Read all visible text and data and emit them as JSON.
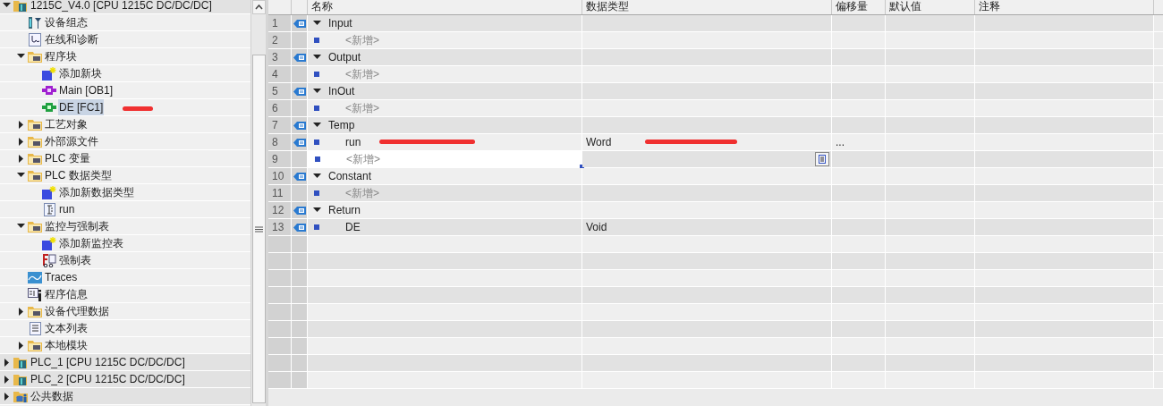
{
  "project_tree": {
    "items": [
      {
        "label": "1215C_V4.0 [CPU 1215C DC/DC/DC]",
        "kind": "plc",
        "expanded": true,
        "selected": false,
        "children": [
          {
            "label": "设备组态",
            "kind": "config",
            "selected": false
          },
          {
            "label": "在线和诊断",
            "kind": "diag",
            "selected": false
          },
          {
            "label": "程序块",
            "kind": "folder",
            "expanded": true,
            "selected": false,
            "children": [
              {
                "label": "添加新块",
                "kind": "add",
                "selected": false
              },
              {
                "label": "Main [OB1]",
                "kind": "ob",
                "selected": false
              },
              {
                "label": "DE [FC1]",
                "kind": "fc",
                "selected": true
              }
            ]
          },
          {
            "label": "工艺对象",
            "kind": "folder",
            "expanded": false,
            "selected": false
          },
          {
            "label": "外部源文件",
            "kind": "folder",
            "expanded": false,
            "selected": false
          },
          {
            "label": "PLC 变量",
            "kind": "folder",
            "expanded": false,
            "selected": false
          },
          {
            "label": "PLC 数据类型",
            "kind": "folder",
            "expanded": true,
            "selected": false,
            "children": [
              {
                "label": "添加新数据类型",
                "kind": "add",
                "selected": false
              },
              {
                "label": "run",
                "kind": "type",
                "selected": false
              }
            ]
          },
          {
            "label": "监控与强制表",
            "kind": "folder",
            "expanded": true,
            "selected": false,
            "children": [
              {
                "label": "添加新监控表",
                "kind": "add",
                "selected": false
              },
              {
                "label": "强制表",
                "kind": "force",
                "selected": false
              }
            ]
          },
          {
            "label": "Traces",
            "kind": "trace",
            "selected": false
          },
          {
            "label": "程序信息",
            "kind": "info",
            "selected": false
          },
          {
            "label": "设备代理数据",
            "kind": "folder",
            "expanded": false,
            "selected": false
          },
          {
            "label": "文本列表",
            "kind": "textlist",
            "selected": false
          },
          {
            "label": "本地模块",
            "kind": "folder",
            "expanded": false,
            "selected": false
          }
        ]
      },
      {
        "label": "PLC_1 [CPU 1215C DC/DC/DC]",
        "kind": "plc",
        "expanded": false,
        "selected": false
      },
      {
        "label": "PLC_2 [CPU 1215C DC/DC/DC]",
        "kind": "plc",
        "expanded": false,
        "selected": false
      },
      {
        "label": "公共数据",
        "kind": "common",
        "expanded": false,
        "selected": false
      }
    ]
  },
  "interface_table": {
    "columns": [
      "名称",
      "数据类型",
      "偏移量",
      "默认值",
      "注释"
    ],
    "rows": [
      {
        "number": "1",
        "kind": "section",
        "name": "Input",
        "selected": false
      },
      {
        "number": "2",
        "kind": "new",
        "name": "<新增>",
        "selected": false
      },
      {
        "number": "3",
        "kind": "section",
        "name": "Output",
        "selected": false
      },
      {
        "number": "4",
        "kind": "new",
        "name": "<新增>",
        "selected": false
      },
      {
        "number": "5",
        "kind": "section",
        "name": "InOut",
        "selected": false
      },
      {
        "number": "6",
        "kind": "new",
        "name": "<新增>",
        "selected": false
      },
      {
        "number": "7",
        "kind": "section",
        "name": "Temp",
        "selected": false
      },
      {
        "number": "8",
        "kind": "var",
        "name": "run",
        "data_type": "Word",
        "offset": "...",
        "selected": false
      },
      {
        "number": "9",
        "kind": "new",
        "name": "<新增>",
        "selected": true
      },
      {
        "number": "10",
        "kind": "section",
        "name": "Constant",
        "selected": false
      },
      {
        "number": "11",
        "kind": "new",
        "name": "<新增>",
        "selected": false
      },
      {
        "number": "12",
        "kind": "section",
        "name": "Return",
        "selected": false
      },
      {
        "number": "13",
        "kind": "var",
        "name": "DE",
        "data_type": "Void",
        "selected": false
      }
    ]
  }
}
